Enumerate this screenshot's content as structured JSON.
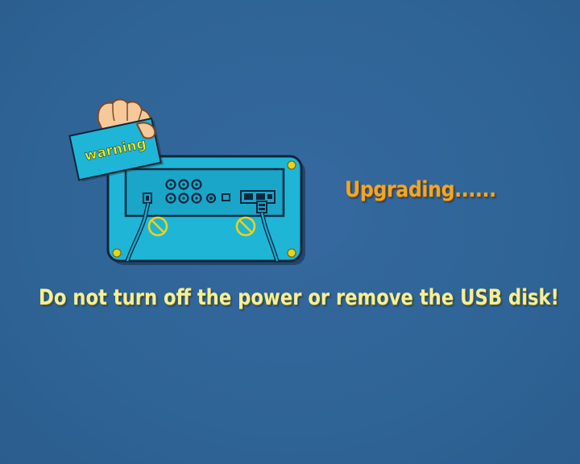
{
  "card": {
    "label": "warning"
  },
  "status": {
    "text": "Upgrading......"
  },
  "message": {
    "text": "Do not turn off the power or remove the USB disk!"
  },
  "icons": {
    "card": "warning-card-icon",
    "device": "device-rear-panel-icon",
    "no_power": "no-unplug-power-icon",
    "no_usb": "no-unplug-usb-icon"
  },
  "colors": {
    "background": "#2f6496",
    "status_text": "#f3a624",
    "message_text": "#f4ef98",
    "device_panel": "#1fb5d6",
    "warning_label": "#f4f000"
  }
}
